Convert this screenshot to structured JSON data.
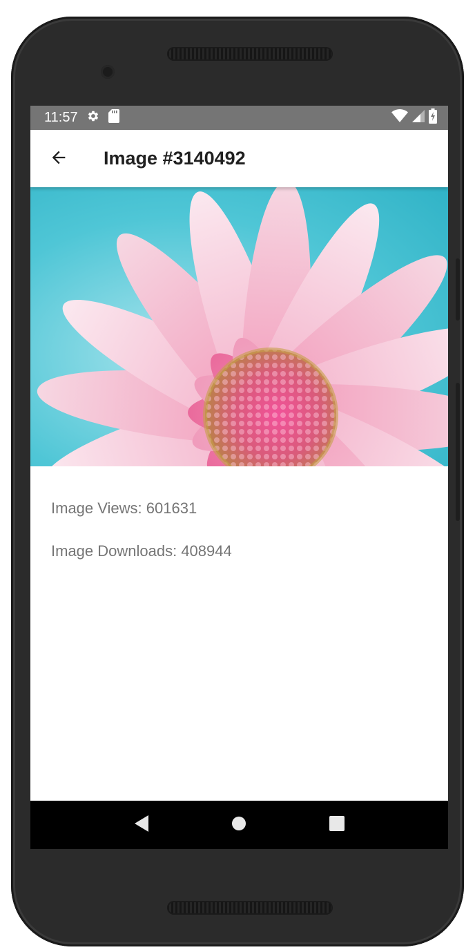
{
  "status_bar": {
    "time": "11:57",
    "icons": [
      "settings-icon",
      "sd-card-icon",
      "wifi-icon",
      "signal-icon",
      "battery-charging-icon"
    ]
  },
  "app_bar": {
    "title": "Image #3140492",
    "back_icon": "arrow-back-icon"
  },
  "image": {
    "subject": "pink daisy flower"
  },
  "stats": {
    "views": "Image Views: 601631",
    "downloads": "Image Downloads: 408944"
  },
  "nav_bar": {
    "icons": [
      "nav-back-icon",
      "nav-home-icon",
      "nav-recents-icon"
    ]
  },
  "colors": {
    "status_bar": "#757575",
    "app_bar": "#ffffff",
    "nav_bar": "#000000",
    "stat_text": "#757575",
    "title_text": "#202020"
  }
}
